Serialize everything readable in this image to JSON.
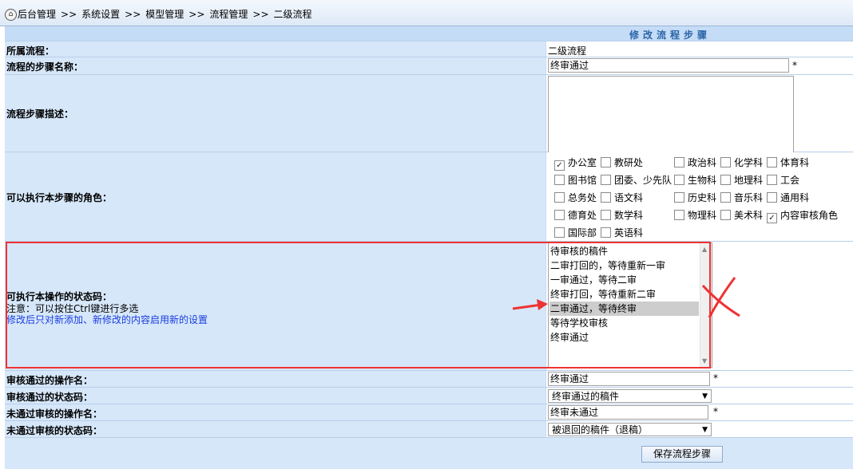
{
  "breadcrumb": {
    "items": [
      "后台管理",
      "系统设置",
      "模型管理",
      "流程管理",
      "二级流程"
    ],
    "separator": ">>"
  },
  "header": {
    "title": "修改流程步骤"
  },
  "form": {
    "process_label": "所属流程：",
    "process_value": "二级流程",
    "step_name_label": "流程的步骤名称：",
    "step_name_value": "终审通过",
    "required_mark": "*",
    "step_desc_label": "流程步骤描述：",
    "step_desc_value": "",
    "roles_label": "可以执行本步骤的角色：",
    "roles": [
      {
        "label": "办公室",
        "checked": true
      },
      {
        "label": "教研处",
        "checked": false
      },
      {
        "label": "政治科",
        "checked": false
      },
      {
        "label": "化学科",
        "checked": false
      },
      {
        "label": "体育科",
        "checked": false
      },
      {
        "label": "图书馆",
        "checked": false
      },
      {
        "label": "团委、少先队",
        "checked": false
      },
      {
        "label": "生物科",
        "checked": false
      },
      {
        "label": "地理科",
        "checked": false
      },
      {
        "label": "工会",
        "checked": false
      },
      {
        "label": "总务处",
        "checked": false
      },
      {
        "label": "语文科",
        "checked": false
      },
      {
        "label": "历史科",
        "checked": false
      },
      {
        "label": "音乐科",
        "checked": false
      },
      {
        "label": "通用科",
        "checked": false
      },
      {
        "label": "德育处",
        "checked": false
      },
      {
        "label": "数学科",
        "checked": false
      },
      {
        "label": "物理科",
        "checked": false
      },
      {
        "label": "美术科",
        "checked": false
      },
      {
        "label": "内容审核角色",
        "checked": true
      },
      {
        "label": "国际部",
        "checked": false
      },
      {
        "label": "英语科",
        "checked": false
      }
    ],
    "status_label": "可执行本操作的状态码：",
    "status_note": "注意：可以按住Ctrl键进行多选",
    "status_note2": "修改后只对新添加、新修改的内容启用新的设置",
    "status_options": [
      {
        "label": "待审核的稿件",
        "selected": false
      },
      {
        "label": "二审打回的，等待重新一审",
        "selected": false
      },
      {
        "label": "一审通过，等待二审",
        "selected": false
      },
      {
        "label": "终审打回，等待重新二审",
        "selected": false
      },
      {
        "label": "二审通过，等待终审",
        "selected": true
      },
      {
        "label": "等待学校审核",
        "selected": false
      },
      {
        "label": "终审通过",
        "selected": false
      }
    ],
    "pass_op_label": "审核通过的操作名：",
    "pass_op_value": "终审通过",
    "pass_status_label": "审核通过的状态码：",
    "pass_status_value": "终审通过的稿件",
    "fail_op_label": "未通过审核的操作名：",
    "fail_op_value": "终审未通过",
    "fail_status_label": "未通过审核的状态码：",
    "fail_status_value": "被退回的稿件（退稿）",
    "save_button": "保存流程步骤"
  },
  "colors": {
    "label_bg": "#d6e7fa",
    "header_bg": "#c4dcf6",
    "header_text": "#2b64a8",
    "annotation": "#e33333",
    "note_blue": "#1a3de0"
  }
}
